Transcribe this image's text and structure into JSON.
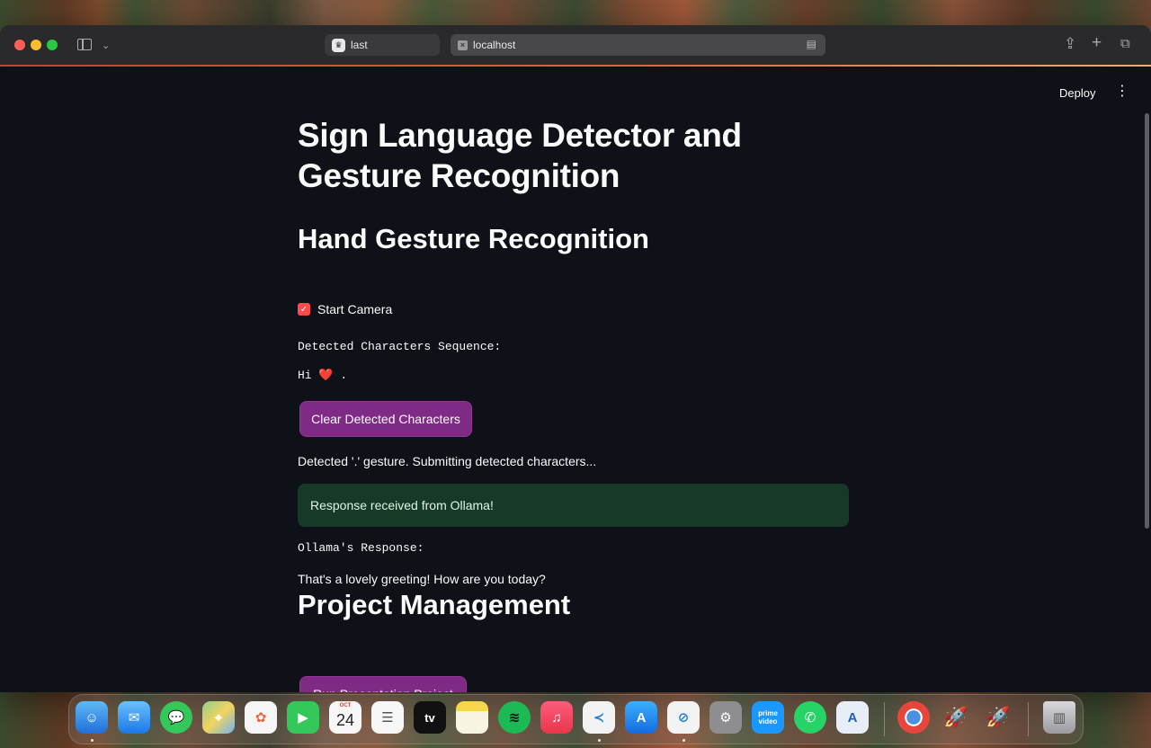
{
  "browser": {
    "tabs": [
      {
        "label": "last",
        "favicon": "crown-icon"
      },
      {
        "label": "localhost",
        "favicon": "close-square-icon"
      }
    ]
  },
  "app": {
    "deploy_label": "Deploy",
    "menu_icon": "⋮",
    "title": "Sign Language Detector and Gesture Recognition",
    "section_gesture": "Hand Gesture Recognition",
    "checkbox_label": "Start Camera",
    "checkbox_checked": true,
    "detected_label": "Detected Characters Sequence:",
    "detected_sequence_prefix": "Hi",
    "detected_sequence_heart": "❤️",
    "detected_sequence_suffix": " .",
    "clear_button": "Clear Detected Characters",
    "gesture_status": "Detected '.' gesture. Submitting detected characters...",
    "success_message": "Response received from Ollama!",
    "response_label": "Ollama's Response:",
    "response_text": "That's a lovely greeting! How are you today?",
    "section_project": "Project Management",
    "run_button": "Run Presentation Project"
  },
  "colors": {
    "background": "#0e1117",
    "button": "#7f2a85",
    "checkbox": "#ff4b4b",
    "success_bg": "#173928"
  },
  "dock": {
    "calendar_month": "OCT",
    "calendar_day": "24",
    "apps": [
      "finder-icon",
      "mail-icon",
      "messages-icon",
      "maps-icon",
      "photos-icon",
      "facetime-icon",
      "calendar-icon",
      "reminders-icon",
      "apple-tv-icon",
      "notes-icon",
      "spotify-icon",
      "music-icon",
      "vscode-icon",
      "app-store-icon",
      "safari-icon",
      "system-settings-icon",
      "prime-video-icon",
      "whatsapp-icon",
      "xcode-instruments-icon",
      "chrome-icon",
      "rocket-icon",
      "rocket-icon",
      "trash-icon"
    ],
    "labels": {
      "apple_tv": "tv",
      "prime": "prime video"
    }
  }
}
